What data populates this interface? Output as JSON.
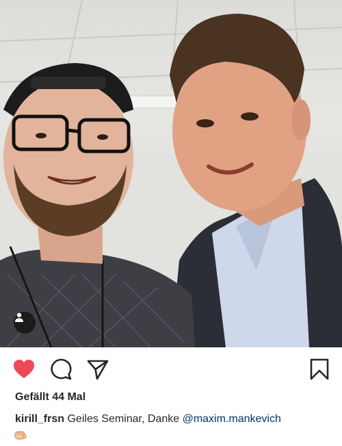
{
  "post": {
    "likes_text": "Gefällt 44 Mal",
    "caption": {
      "username": "kirill_frsn",
      "text": "Geiles Seminar, Danke",
      "mention": "@maxim.mankevich",
      "emoji": "fist-bump"
    },
    "liked": true
  },
  "icons": {
    "user_tag": "person-icon",
    "like": "heart-icon",
    "comment": "comment-icon",
    "share": "paper-plane-icon",
    "save": "bookmark-icon"
  },
  "colors": {
    "heart": "#ed4956",
    "text": "#262626",
    "mention": "#003569"
  }
}
